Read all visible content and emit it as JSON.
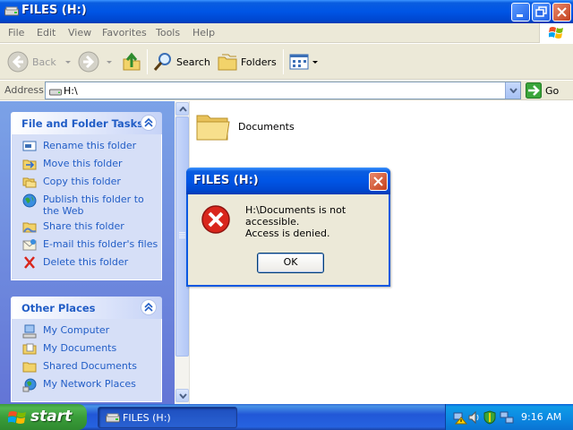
{
  "window": {
    "title": "FILES (H:)"
  },
  "menu": {
    "file": "File",
    "edit": "Edit",
    "view": "View",
    "favorites": "Favorites",
    "tools": "Tools",
    "help": "Help"
  },
  "toolbar": {
    "back": "Back",
    "search": "Search",
    "folders": "Folders"
  },
  "address": {
    "label": "Address",
    "value": "H:\\",
    "go": "Go"
  },
  "tasks_panel": {
    "title": "File and Folder Tasks",
    "items": [
      "Rename this folder",
      "Move this folder",
      "Copy this folder",
      "Publish this folder to the Web",
      "Share this folder",
      "E-mail this folder's files",
      "Delete this folder"
    ]
  },
  "places_panel": {
    "title": "Other Places",
    "items": [
      "My Computer",
      "My Documents",
      "Shared Documents",
      "My Network Places"
    ]
  },
  "content": {
    "folder_name": "Documents"
  },
  "dialog": {
    "title": "FILES (H:)",
    "message1": "H:\\Documents is not accessible.",
    "message2": "Access is denied.",
    "ok": "OK"
  },
  "taskbar": {
    "start": "start",
    "task_label": "FILES (H:)",
    "clock": "9:16 AM"
  },
  "colors": {
    "titlebar_blue": "#0055e5",
    "taskpane_link": "#215dc6",
    "start_green": "#3a9d3a",
    "error_red": "#d9261c"
  }
}
